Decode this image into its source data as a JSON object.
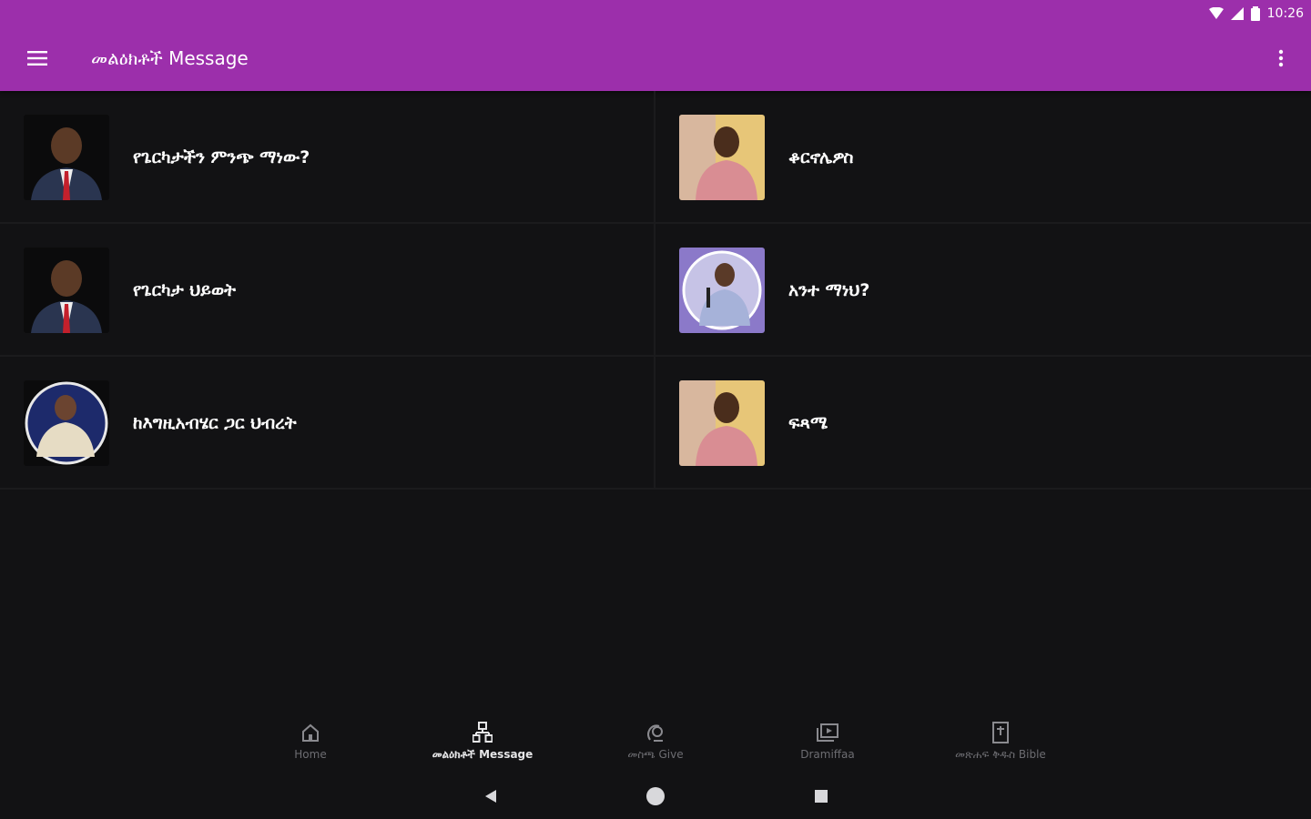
{
  "status_bar": {
    "time": "10:26"
  },
  "app_bar": {
    "title": "መልዕክቶች Message"
  },
  "cards": [
    {
      "label": "የጌርካታችን ምንጭ ማነው?",
      "thumb": "speaker-red-tie"
    },
    {
      "label": "ቆርኖሌዎስ",
      "thumb": "speaker-pink-shirt"
    },
    {
      "label": "የጌርካታ ህይወት",
      "thumb": "speaker-red-tie"
    },
    {
      "label": "አንተ ማነህ?",
      "thumb": "speaker-purple-circle"
    },
    {
      "label": "ከእግዚአብሄር ጋር ህብረት",
      "thumb": "speaker-blue-circle"
    },
    {
      "label": "ፍጻሜ",
      "thumb": "speaker-pink-shirt"
    }
  ],
  "bottom_nav": [
    {
      "label": "Home",
      "icon": "home-icon"
    },
    {
      "label": "መልዕክቶች Message",
      "icon": "message-sitemap-icon",
      "active": true
    },
    {
      "label": "መስጫ Give",
      "icon": "give-icon"
    },
    {
      "label": "Dramiffaa",
      "icon": "video-library-icon"
    },
    {
      "label": "መጽሐፍ ቅዱስ Bible",
      "icon": "bible-icon"
    }
  ],
  "colors": {
    "accent": "#9c2fab",
    "background": "#121214"
  }
}
